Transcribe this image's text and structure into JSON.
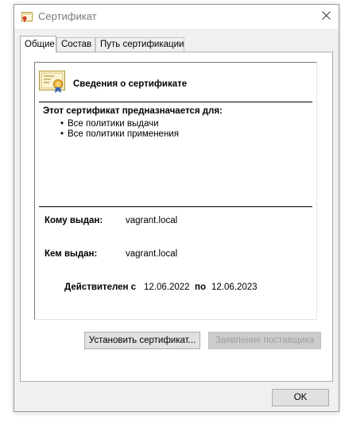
{
  "window": {
    "title": "Сертификат",
    "title_icon": "certificate-icon",
    "close_icon": "close-icon"
  },
  "tabs": [
    {
      "label": "Общие",
      "active": true
    },
    {
      "label": "Состав",
      "active": false
    },
    {
      "label": "Путь сертификации",
      "active": false
    }
  ],
  "general": {
    "header": "Сведения о сертификате",
    "purpose_title": "Этот сертификат предназначается для:",
    "purposes": [
      "Все политики выдачи",
      "Все политики применения"
    ],
    "issued_to_label": "Кому выдан:",
    "issued_to": "vagrant.local",
    "issued_by_label": "Кем выдан:",
    "issued_by": "vagrant.local",
    "valid_from_label": "Действителен с",
    "valid_from": "12.06.2022",
    "valid_to_label": "по",
    "valid_to": "12.06.2023"
  },
  "buttons": {
    "install": "Установить сертификат...",
    "issuer_statement": "Заявление поставщика",
    "ok": "OK"
  },
  "colors": {
    "window_bg": "#f0f0f0",
    "panel_bg": "#ffffff",
    "button_bg": "#e1e1e1",
    "disabled_text": "#a0a0a0"
  }
}
